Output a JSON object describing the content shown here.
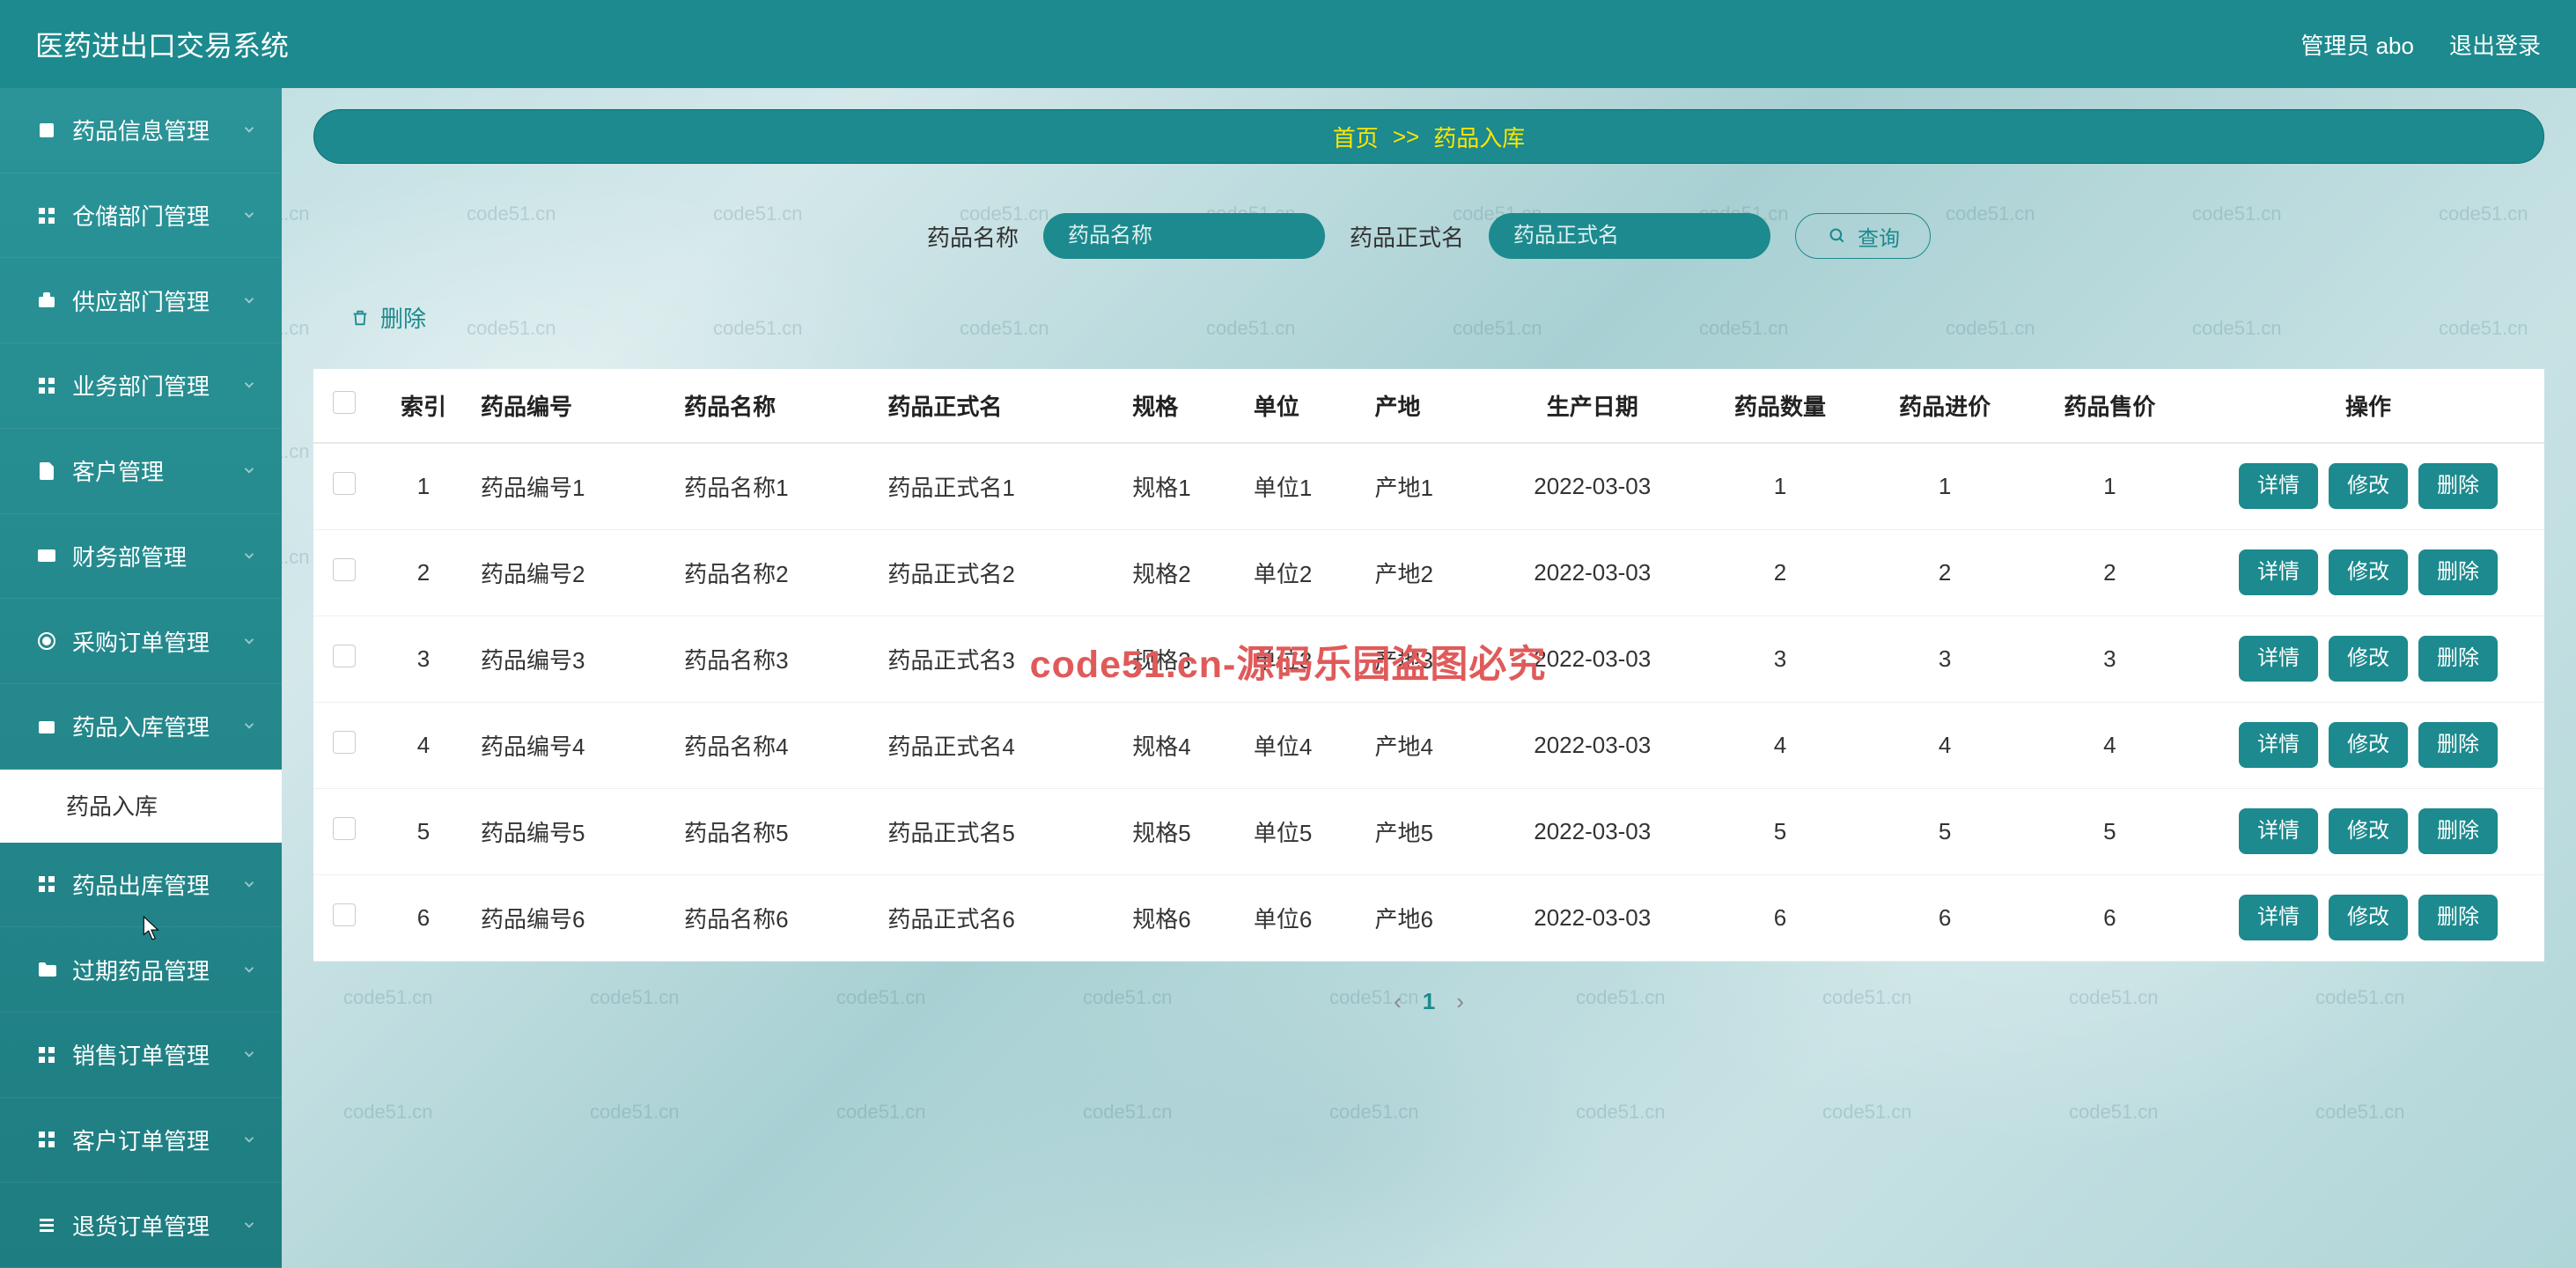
{
  "app_title": "医药进出口交易系统",
  "header": {
    "user_label": "管理员 abo",
    "logout_label": "退出登录"
  },
  "sidebar": {
    "items": [
      {
        "icon": "square-icon",
        "label": "药品信息管理"
      },
      {
        "icon": "grid-icon",
        "label": "仓储部门管理"
      },
      {
        "icon": "briefcase-icon",
        "label": "供应部门管理"
      },
      {
        "icon": "grid-icon",
        "label": "业务部门管理"
      },
      {
        "icon": "document-icon",
        "label": "客户管理"
      },
      {
        "icon": "card-icon",
        "label": "财务部管理"
      },
      {
        "icon": "tag-icon",
        "label": "采购订单管理"
      },
      {
        "icon": "inbox-icon",
        "label": "药品入库管理"
      },
      {
        "icon": "",
        "label": "药品入库",
        "active": true
      },
      {
        "icon": "grid-icon",
        "label": "药品出库管理"
      },
      {
        "icon": "folder-icon",
        "label": "过期药品管理"
      },
      {
        "icon": "grid-icon",
        "label": "销售订单管理"
      },
      {
        "icon": "grid-icon",
        "label": "客户订单管理"
      },
      {
        "icon": "list-icon",
        "label": "退货订单管理"
      }
    ]
  },
  "breadcrumb": {
    "home": "首页",
    "sep": ">>",
    "current": "药品入库"
  },
  "search": {
    "name_label": "药品名称",
    "name_placeholder": "药品名称",
    "formal_label": "药品正式名",
    "formal_placeholder": "药品正式名",
    "query_btn": "查询"
  },
  "toolbar": {
    "delete_label": "删除"
  },
  "table": {
    "headers": [
      "",
      "索引",
      "药品编号",
      "药品名称",
      "药品正式名",
      "规格",
      "单位",
      "产地",
      "生产日期",
      "药品数量",
      "药品进价",
      "药品售价",
      "操作"
    ],
    "rows": [
      {
        "idx": "1",
        "code": "药品编号1",
        "name": "药品名称1",
        "formal": "药品正式名1",
        "spec": "规格1",
        "unit": "单位1",
        "origin": "产地1",
        "date": "2022-03-03",
        "qty": "1",
        "bid": "1",
        "ask": "1"
      },
      {
        "idx": "2",
        "code": "药品编号2",
        "name": "药品名称2",
        "formal": "药品正式名2",
        "spec": "规格2",
        "unit": "单位2",
        "origin": "产地2",
        "date": "2022-03-03",
        "qty": "2",
        "bid": "2",
        "ask": "2"
      },
      {
        "idx": "3",
        "code": "药品编号3",
        "name": "药品名称3",
        "formal": "药品正式名3",
        "spec": "规格3",
        "unit": "单位3",
        "origin": "产地3",
        "date": "2022-03-03",
        "qty": "3",
        "bid": "3",
        "ask": "3"
      },
      {
        "idx": "4",
        "code": "药品编号4",
        "name": "药品名称4",
        "formal": "药品正式名4",
        "spec": "规格4",
        "unit": "单位4",
        "origin": "产地4",
        "date": "2022-03-03",
        "qty": "4",
        "bid": "4",
        "ask": "4"
      },
      {
        "idx": "5",
        "code": "药品编号5",
        "name": "药品名称5",
        "formal": "药品正式名5",
        "spec": "规格5",
        "unit": "单位5",
        "origin": "产地5",
        "date": "2022-03-03",
        "qty": "5",
        "bid": "5",
        "ask": "5"
      },
      {
        "idx": "6",
        "code": "药品编号6",
        "name": "药品名称6",
        "formal": "药品正式名6",
        "spec": "规格6",
        "unit": "单位6",
        "origin": "产地6",
        "date": "2022-03-03",
        "qty": "6",
        "bid": "6",
        "ask": "6"
      }
    ],
    "actions": {
      "detail": "详情",
      "edit": "修改",
      "delete": "删除"
    }
  },
  "pagination": {
    "prev": "‹",
    "current": "1",
    "next": "›"
  },
  "watermark": {
    "big": "code51.cn-源码乐园盗图必究",
    "small": "code51.cn"
  },
  "colors": {
    "primary": "#1c8a8e"
  }
}
